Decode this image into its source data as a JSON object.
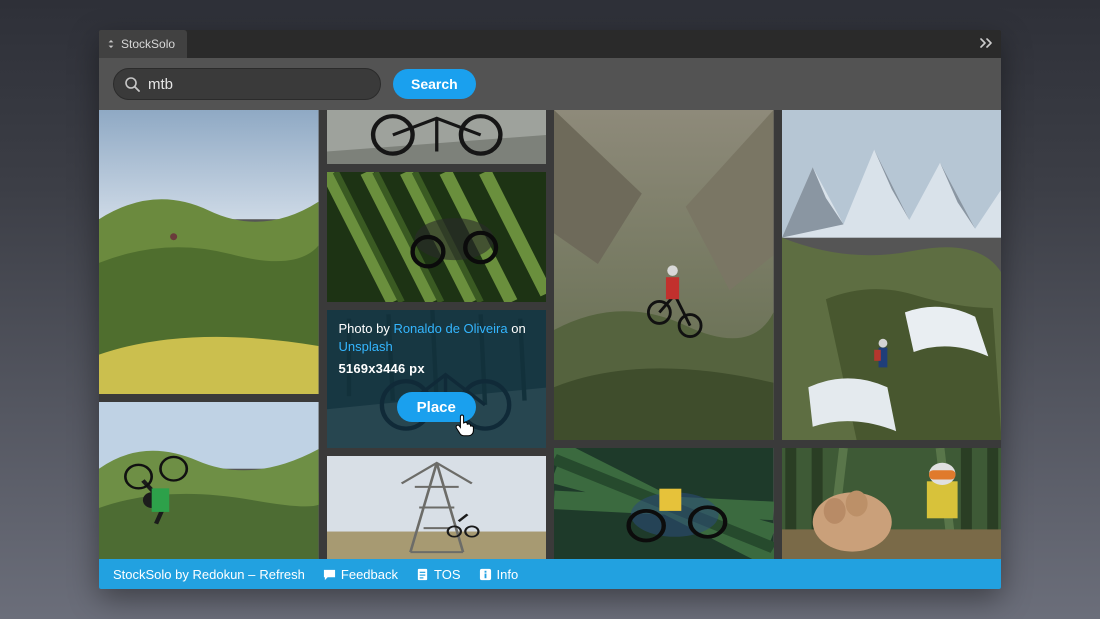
{
  "tab": {
    "title": "StockSolo"
  },
  "search": {
    "value": "mtb",
    "placeholder": "",
    "button": "Search"
  },
  "card": {
    "prefix": "Photo by ",
    "author": "Ronaldo de Oliveira",
    "on": " on ",
    "source": "Unsplash",
    "dimensions": "5169x3446 px",
    "place": "Place"
  },
  "footer": {
    "brand_prefix": "StockSolo by Redokun – ",
    "refresh": "Refresh",
    "feedback": "Feedback",
    "tos": "TOS",
    "info": "Info"
  }
}
